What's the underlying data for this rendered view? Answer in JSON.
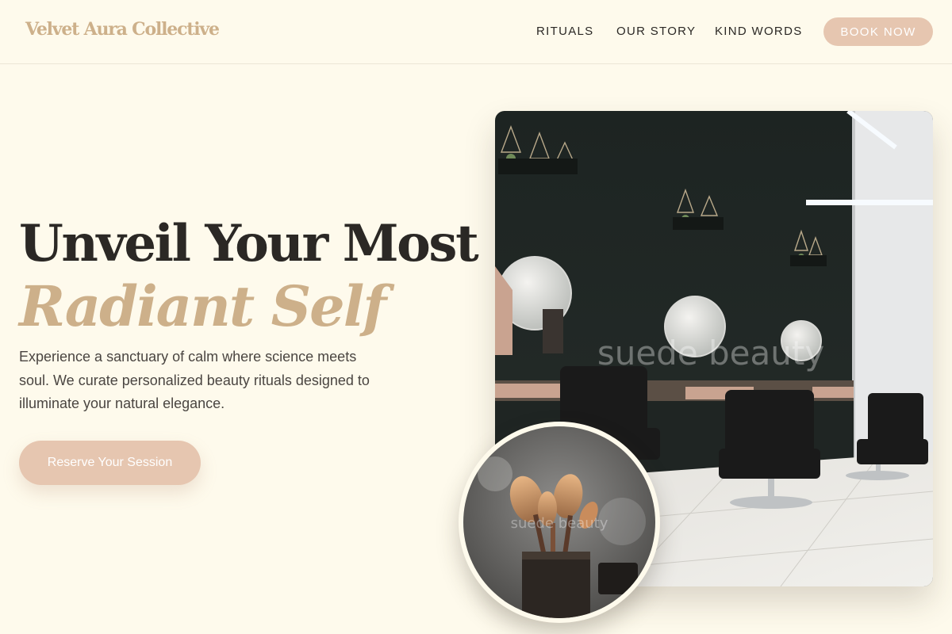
{
  "header": {
    "brand": "Velvet Aura Collective",
    "nav": [
      "Rituals",
      "Our Story",
      "Kind Words"
    ],
    "cta": "Book Now"
  },
  "hero": {
    "headline_line1": "Unveil Your Most",
    "headline_line2": "Radiant Self",
    "description": "Experience a sanctuary of calm where science meets soul. We curate personalized beauty rituals designed to illuminate your natural elegance.",
    "cta": "Reserve Your Session"
  },
  "images": {
    "main_watermark": "suede beauty",
    "round_watermark": "suede beauty"
  },
  "colors": {
    "background": "#fefaec",
    "accent_gold": "#cdb08a",
    "button_blush": "#e6c6b0",
    "text_dark": "#2b2825"
  }
}
